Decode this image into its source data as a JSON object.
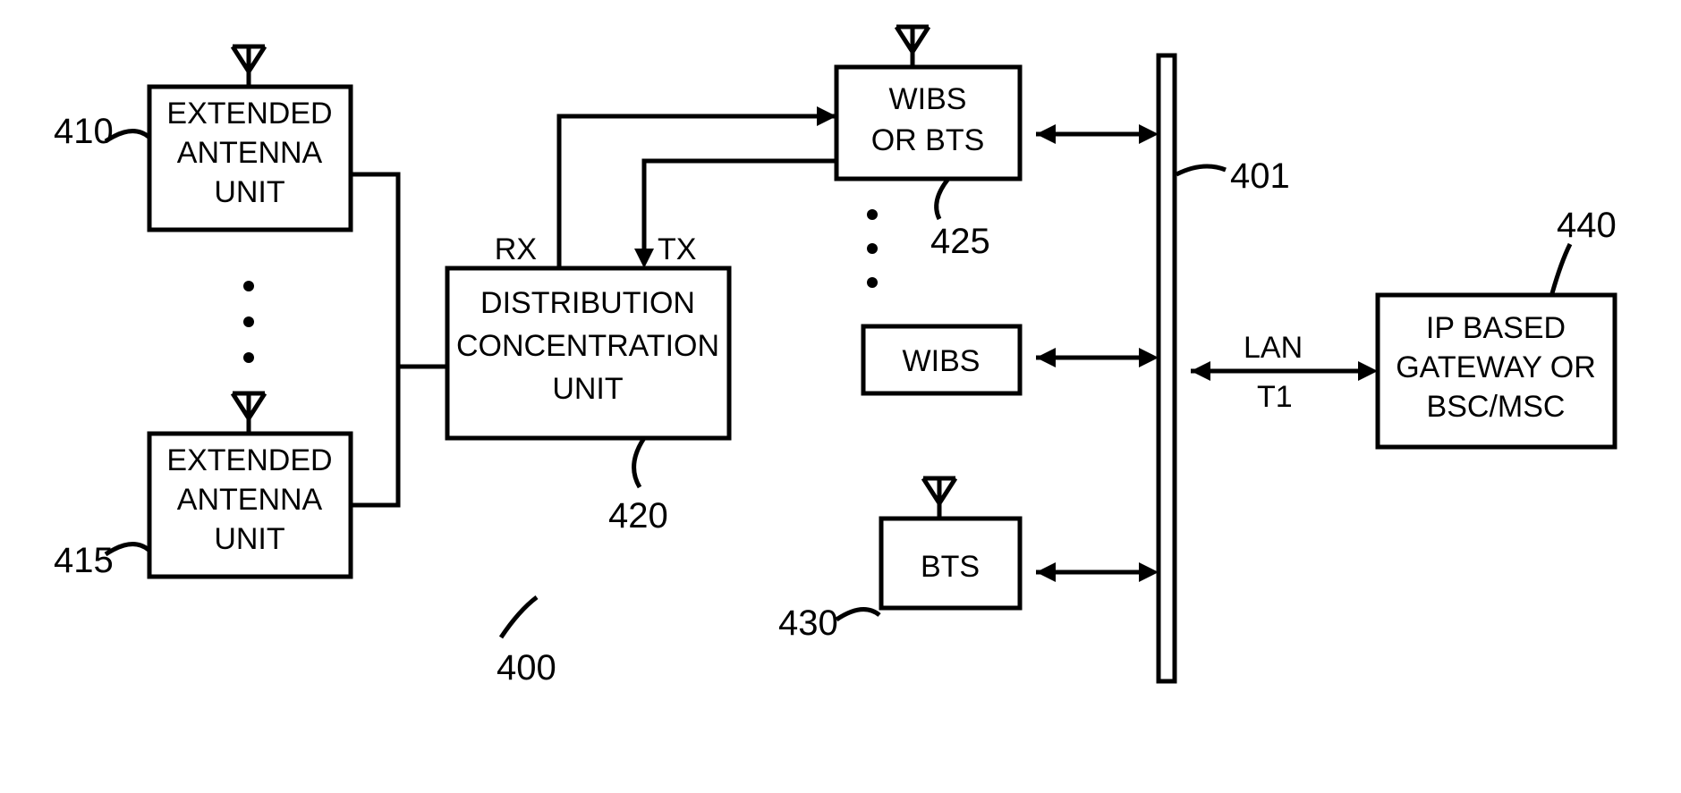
{
  "diagram_id": "400",
  "blocks": {
    "eau1": {
      "ref": "410",
      "line1": "EXTENDED",
      "line2": "ANTENNA",
      "line3": "UNIT"
    },
    "eau2": {
      "ref": "415",
      "line1": "EXTENDED",
      "line2": "ANTENNA",
      "line3": "UNIT"
    },
    "dcu": {
      "ref": "420",
      "line1": "DISTRIBUTION",
      "line2": "CONCENTRATION",
      "line3": "UNIT"
    },
    "wibs_bts": {
      "ref": "425",
      "line1": "WIBS",
      "line2": "OR BTS"
    },
    "wibs": {
      "label": "WIBS"
    },
    "bts": {
      "ref": "430",
      "label": "BTS"
    },
    "gateway": {
      "ref": "440",
      "line1": "IP BASED",
      "line2": "GATEWAY OR",
      "line3": "BSC/MSC"
    }
  },
  "bus": {
    "ref": "401"
  },
  "links": {
    "rx": "RX",
    "tx": "TX",
    "lan": "LAN",
    "t1": "T1"
  }
}
